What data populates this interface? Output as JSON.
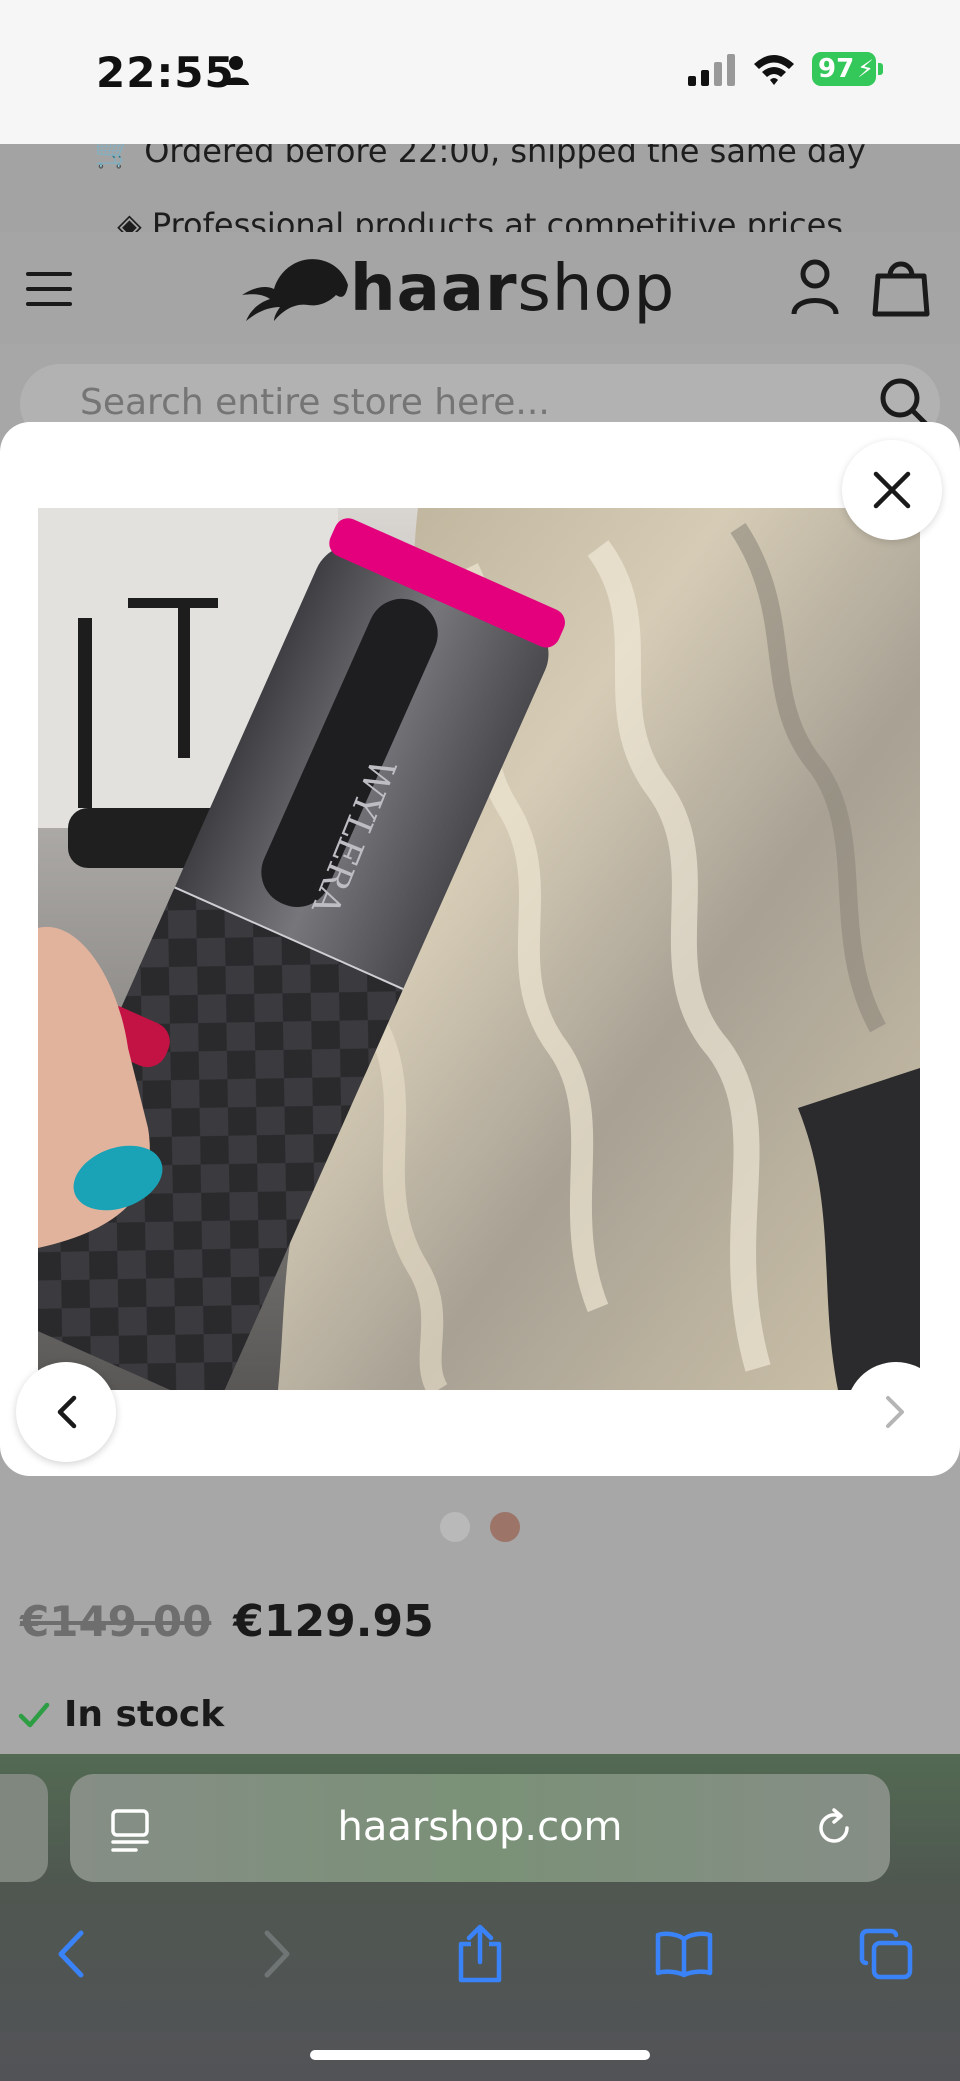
{
  "status_bar": {
    "time": "22:55",
    "battery": "97"
  },
  "promo": {
    "line1": "Ordered before 22:00, shipped the same day",
    "line2": "Professional products at competitive prices"
  },
  "header": {
    "logo_text_bold": "haar",
    "logo_text_light": "shop"
  },
  "search": {
    "placeholder": "Search entire store here..."
  },
  "product": {
    "image_brand_text": "WYLERA",
    "old_price": "€149.00",
    "price": "€129.95",
    "stock_status": "In stock"
  },
  "carousel": {
    "total": 2,
    "active_index": 2
  },
  "browser": {
    "url": "haarshop.com"
  },
  "colors": {
    "accent_pink": "#e4007c",
    "ios_blue": "#3a82f7",
    "stock_green": "#2e9e44",
    "battery_green": "#34c759",
    "dot_active": "#9c7468"
  }
}
